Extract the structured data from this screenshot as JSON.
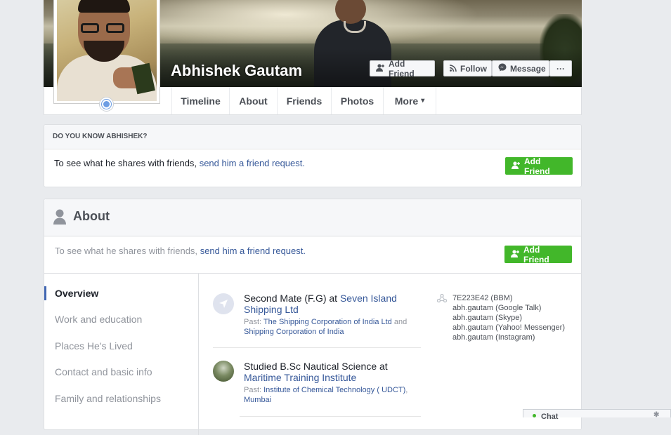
{
  "profile": {
    "name": "Abhishek Gautam"
  },
  "cover_actions": {
    "add_friend": "Add Friend",
    "follow": "Follow",
    "message": "Message",
    "more": "···"
  },
  "nav": {
    "tabs": [
      {
        "label": "Timeline"
      },
      {
        "label": "About"
      },
      {
        "label": "Friends"
      },
      {
        "label": "Photos"
      },
      {
        "label": "More",
        "caret": "▾"
      }
    ]
  },
  "know_card": {
    "header": "DO YOU KNOW ABHISHEK?",
    "text": "To see what he shares with friends,",
    "link": "send him a friend request.",
    "button": "Add Friend"
  },
  "about_card": {
    "title": "About",
    "text": "To see what he shares with friends,",
    "link": "send him a friend request.",
    "button": "Add Friend",
    "sections": [
      {
        "label": "Overview",
        "active": true
      },
      {
        "label": "Work and education"
      },
      {
        "label": "Places He's Lived"
      },
      {
        "label": "Contact and basic info"
      },
      {
        "label": "Family and relationships"
      }
    ],
    "work": {
      "title_prefix": "Second Mate (F.G) at ",
      "title_link": "Seven Island Shipping Ltd",
      "past_label": "Past: ",
      "past_link1": "The Shipping Corporation of India Ltd",
      "past_and": " and ",
      "past_link2": "Shipping Corporation of India"
    },
    "education": {
      "title_prefix": "Studied B.Sc Nautical Science at ",
      "title_link": "Maritime Training Institute",
      "past_label": "Past: ",
      "past_link1": "Institute of Chemical Technology ( UDCT)",
      "past_sep": ",",
      "past_link2": "Mumbai"
    },
    "contacts": [
      "7E223E42 (BBM)",
      "abh.gautam (Google Talk)",
      "abh.gautam (Skype)",
      "abh.gautam (Yahoo! Messenger)",
      "abh.gautam (Instagram)"
    ]
  },
  "chat": {
    "label": "Chat"
  },
  "colors": {
    "link": "#365899",
    "green": "#42b72a",
    "page_bg": "#e9ebee",
    "active_bar": "#4267b2"
  }
}
